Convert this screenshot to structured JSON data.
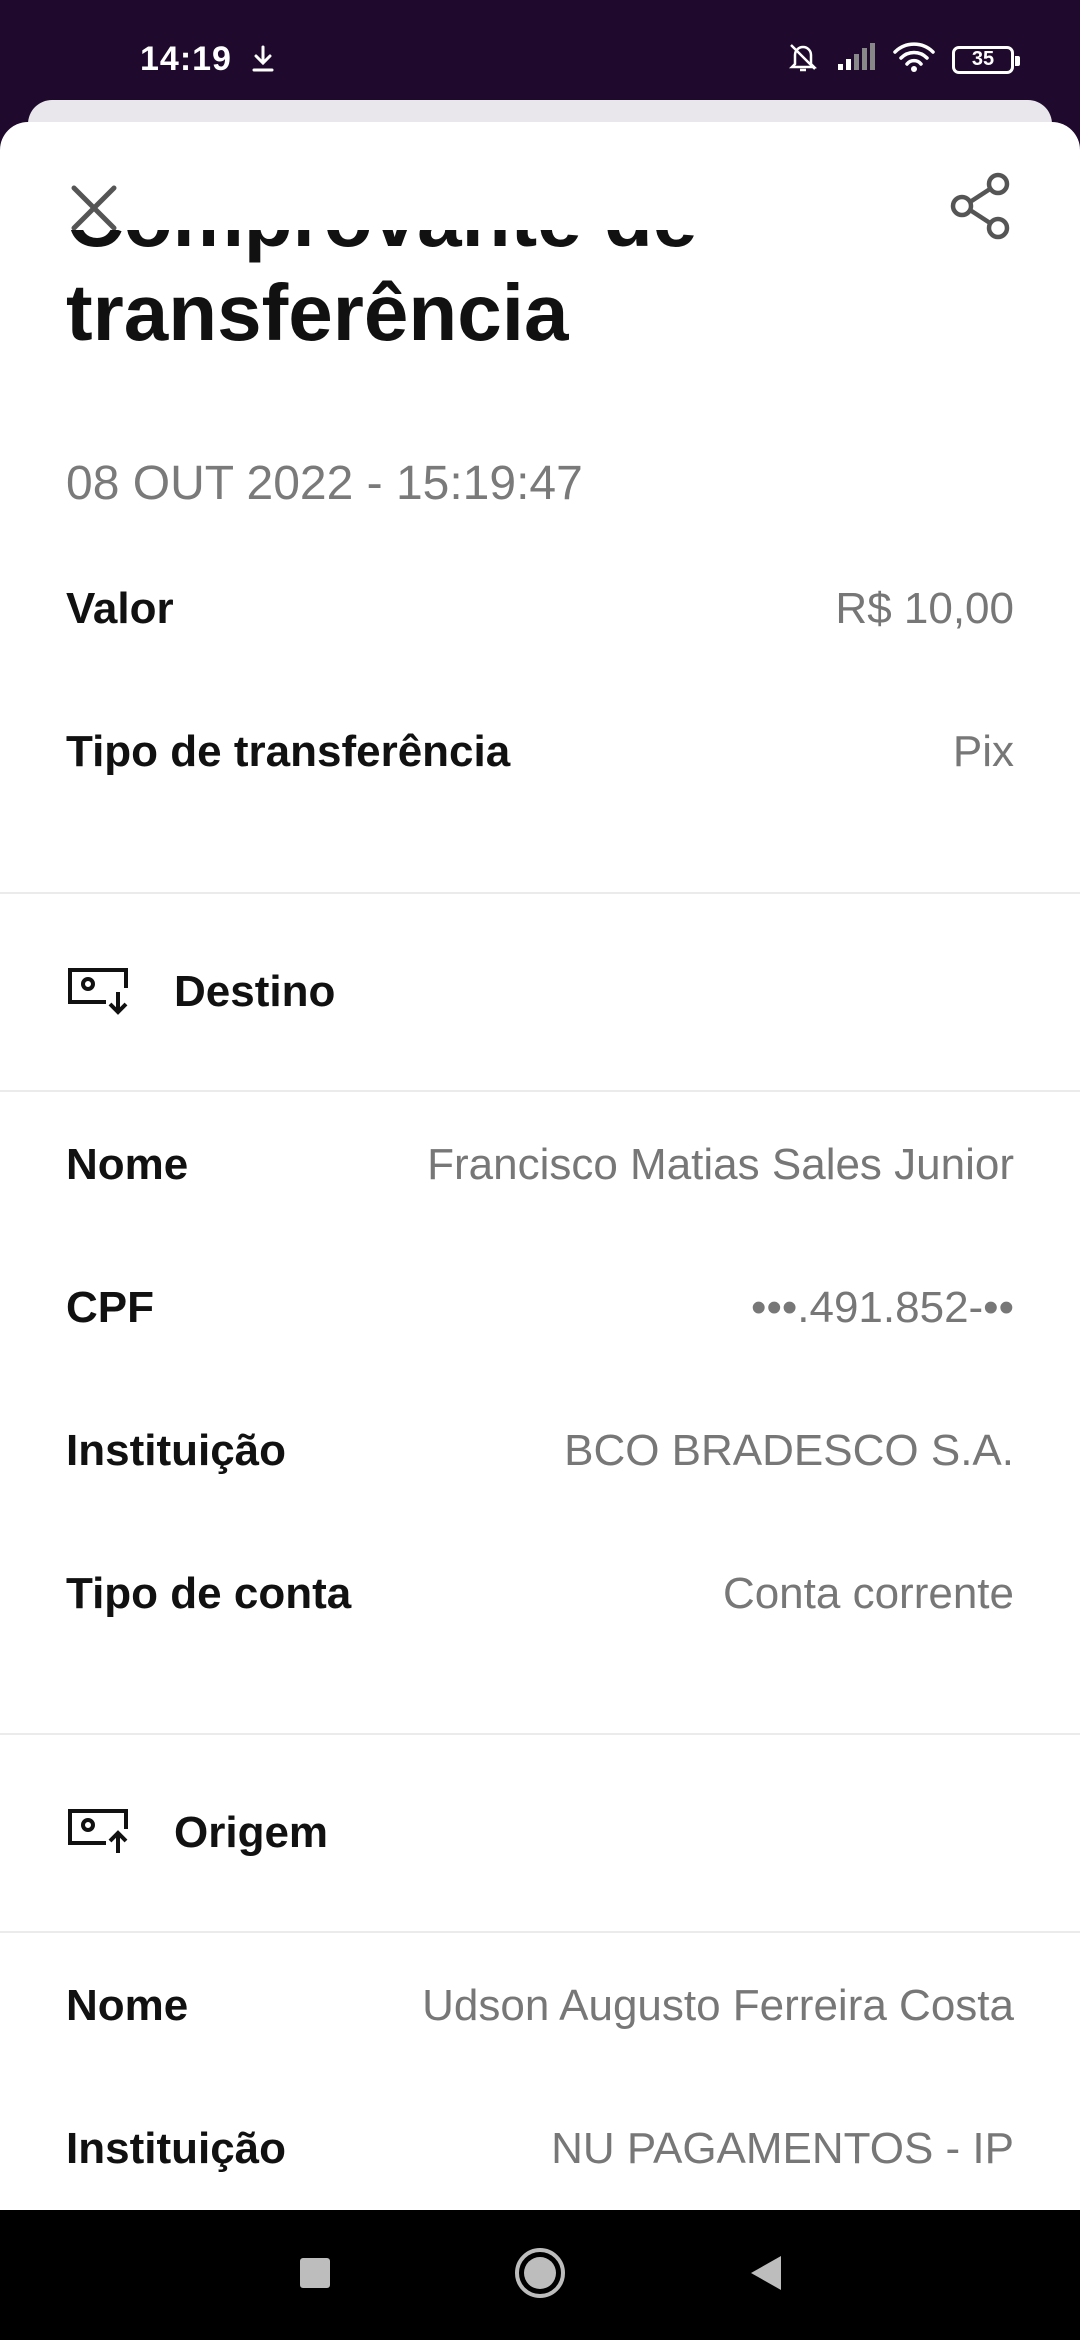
{
  "status_bar": {
    "time": "14:19",
    "battery": "35",
    "icons": [
      "download-icon",
      "bell-off-icon",
      "signal-icon",
      "wifi-icon",
      "battery-icon"
    ]
  },
  "header": {
    "close_icon": "close-icon",
    "share_icon": "share-icon",
    "title_line1": "Comprovante de",
    "title_line2": "transferência",
    "date": "08 OUT 2022 - 15:19:47"
  },
  "summary": {
    "valor_label": "Valor",
    "valor_value": "R$ 10,00",
    "tipo_label": "Tipo de transferência",
    "tipo_value": "Pix"
  },
  "destino": {
    "title": "Destino",
    "icon": "receive-money-icon",
    "nome_label": "Nome",
    "nome_value": "Francisco Matias Sales Junior",
    "cpf_label": "CPF",
    "cpf_value": "•••.491.852-••",
    "instituicao_label": "Instituição",
    "instituicao_value": "BCO BRADESCO S.A.",
    "conta_label": "Tipo de conta",
    "conta_value": "Conta corrente"
  },
  "origem": {
    "title": "Origem",
    "icon": "send-money-icon",
    "nome_label": "Nome",
    "nome_value": "Udson Augusto Ferreira Costa",
    "instituicao_label": "Instituição",
    "instituicao_value": "NU PAGAMENTOS - IP"
  },
  "nav": {
    "icons": [
      "recents-square-icon",
      "home-circle-icon",
      "back-triangle-icon"
    ]
  },
  "colors": {
    "status_bg": "#1f0a2e",
    "text_primary": "#111111",
    "text_secondary": "#777777"
  }
}
